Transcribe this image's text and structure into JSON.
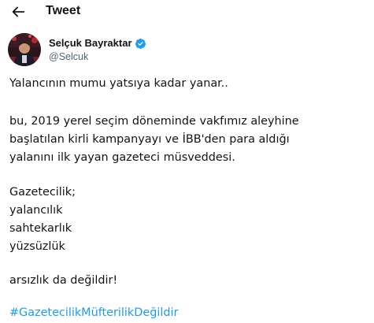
{
  "header": {
    "back_icon": "arrow-left-icon",
    "title": "Tweet"
  },
  "author": {
    "display_name": "Selçuk Bayraktar",
    "handle": "@Selcuk",
    "verified": true,
    "verified_icon": "verified-badge-icon",
    "verified_color": "#1d9bf0"
  },
  "tweet": {
    "lines": [
      "Yalancının mumu yatsıya kadar yanar..",
      "bu, 2019 yerel seçim döneminde vakfımız aleyhine",
      "başlatılan kirli kampanyayı ve İBB'den para aldığı",
      "yalanını ilk yayan gazeteci müsveddesi.",
      "Gazetecilik;",
      "yalancılık",
      "sahtekarlık",
      "yüzsüzlük",
      "arsızlık da değildir!"
    ],
    "hashtag": "#GazetecilikMüfterilikDeğildir",
    "hashtag_color": "#1d9bf0",
    "text_color": "#0f1419"
  }
}
